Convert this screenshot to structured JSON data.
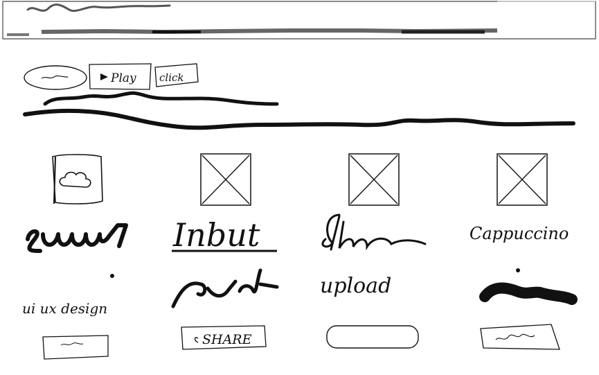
{
  "toolbar": {
    "play_label": "Play",
    "click_label": "click"
  },
  "grid": {
    "labels": [
      "Inbut",
      "Cappuccino",
      "ui ux design",
      "upload"
    ],
    "share_label": "SHARE"
  },
  "icons": {
    "cloud": "cloud-icon",
    "placeholder": "image-placeholder-icon",
    "play": "play-icon",
    "share": "share-icon"
  },
  "colors": {
    "ink": "#111111",
    "soft_ink": "#555555",
    "paper": "#ffffff"
  }
}
